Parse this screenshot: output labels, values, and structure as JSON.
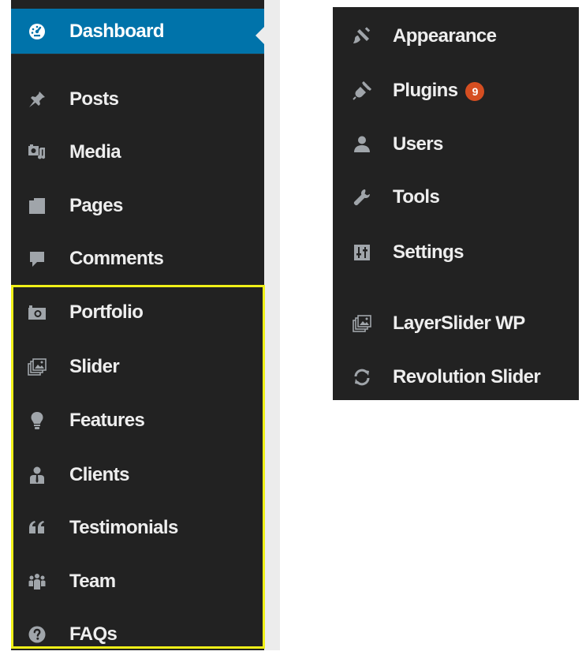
{
  "left_menu": {
    "items": [
      {
        "label": "Dashboard",
        "icon": "dashboard-icon"
      },
      {
        "label": "Posts",
        "icon": "pin-icon"
      },
      {
        "label": "Media",
        "icon": "media-icon"
      },
      {
        "label": "Pages",
        "icon": "pages-icon"
      },
      {
        "label": "Comments",
        "icon": "comment-icon"
      },
      {
        "label": "Portfolio",
        "icon": "camera-icon"
      },
      {
        "label": "Slider",
        "icon": "slides-icon"
      },
      {
        "label": "Features",
        "icon": "lightbulb-icon"
      },
      {
        "label": "Clients",
        "icon": "businessman-icon"
      },
      {
        "label": "Testimonials",
        "icon": "quote-icon"
      },
      {
        "label": "Team",
        "icon": "groups-icon"
      },
      {
        "label": "FAQs",
        "icon": "help-icon"
      }
    ]
  },
  "right_menu": {
    "items": [
      {
        "label": "Appearance",
        "icon": "paintbrush-icon"
      },
      {
        "label": "Plugins",
        "icon": "plugin-icon",
        "badge": "9"
      },
      {
        "label": "Users",
        "icon": "users-icon"
      },
      {
        "label": "Tools",
        "icon": "wrench-icon"
      },
      {
        "label": "Settings",
        "icon": "settings-icon"
      },
      {
        "label": "LayerSlider WP",
        "icon": "slides-icon"
      },
      {
        "label": "Revolution Slider",
        "icon": "refresh-icon"
      }
    ]
  },
  "colors": {
    "menu_bg": "#222222",
    "active_bg": "#0073aa",
    "badge_bg": "#d54e21",
    "highlight_border": "#f0f018",
    "icon": "#a0a5aa"
  }
}
